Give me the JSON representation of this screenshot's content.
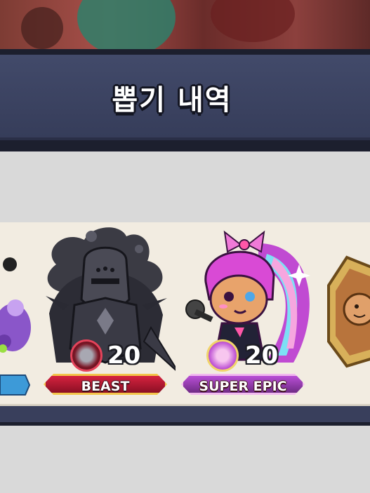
{
  "header": {
    "title": "뽑기 내역"
  },
  "cards": [
    {
      "level": "20",
      "rarity": "BEAST",
      "rarity_color": "#d6233f"
    },
    {
      "level": "20",
      "rarity": "SUPER EPIC",
      "rarity_color": "#b94fd6"
    }
  ]
}
